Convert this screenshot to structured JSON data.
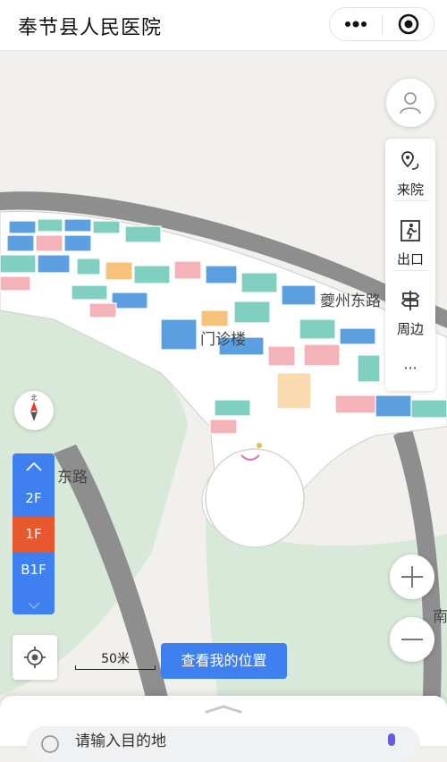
{
  "header": {
    "title": "奉节县人民医院"
  },
  "map": {
    "building_label": "门诊楼",
    "road_labels": [
      "夔州东路",
      "东路",
      "南"
    ]
  },
  "toolbar": {
    "items": [
      {
        "label": "来院",
        "icon": "location-route-icon"
      },
      {
        "label": "出口",
        "icon": "exit-icon"
      },
      {
        "label": "周边",
        "icon": "signpost-icon"
      }
    ],
    "more_label": "···"
  },
  "floors": {
    "items": [
      "2F",
      "1F",
      "B1F"
    ],
    "active": "1F"
  },
  "scale": {
    "label": "50米"
  },
  "actions": {
    "where_am_i": "查看我的位置"
  },
  "search": {
    "placeholder": "请输入目的地"
  },
  "colors": {
    "accent": "#3f80f0",
    "active_floor": "#e8582f",
    "road": "#8e8e8e",
    "room_blue": "#5b9fe0",
    "room_teal": "#7fd0c0",
    "room_pink": "#f4b3b8",
    "room_orange": "#f6c27a"
  }
}
